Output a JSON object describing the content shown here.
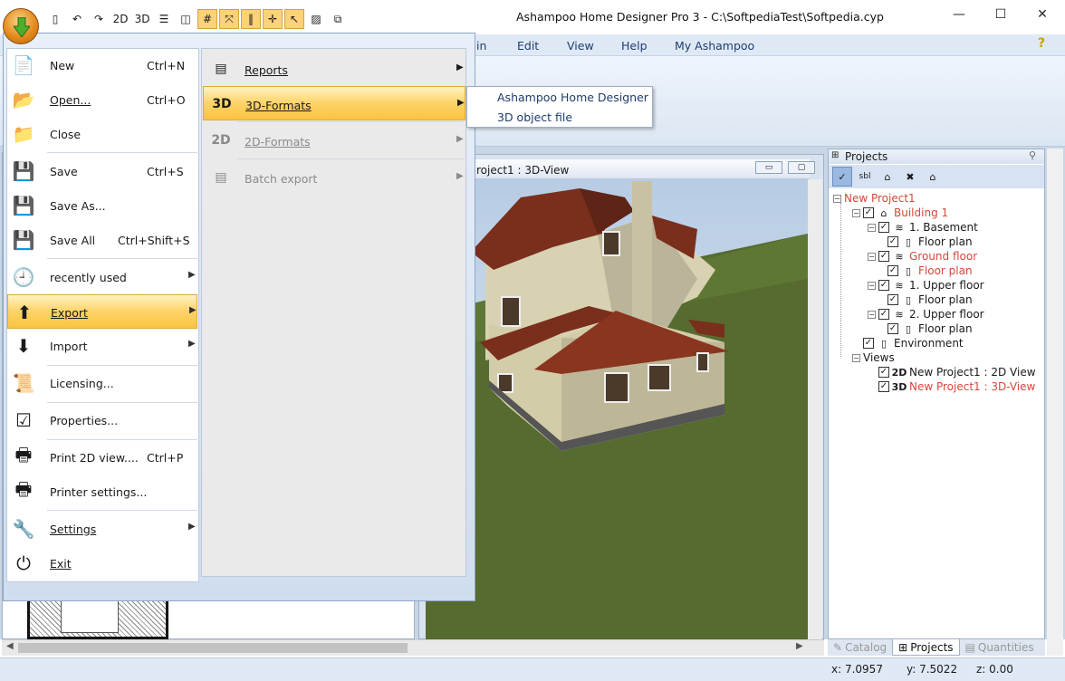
{
  "window": {
    "title": "Ashampoo Home Designer Pro 3 - C:\\SoftpediaTest\\Softpedia.cyp",
    "min_glyph": "—",
    "max_glyph": "☐",
    "close_glyph": "✕"
  },
  "quick_access": [
    {
      "icon": "new-doc-icon",
      "glyph": "▯"
    },
    {
      "icon": "undo-icon",
      "glyph": "↶"
    },
    {
      "icon": "redo-icon",
      "glyph": "↷"
    },
    {
      "icon": "view-2d-icon",
      "glyph": "2D"
    },
    {
      "icon": "view-3d-icon",
      "glyph": "3D"
    },
    {
      "icon": "split-horizontal-icon",
      "glyph": "☰"
    },
    {
      "icon": "split-vertical-icon",
      "glyph": "◫"
    },
    {
      "icon": "grid-icon",
      "glyph": "#"
    },
    {
      "icon": "snap-icon",
      "glyph": "⤧"
    },
    {
      "icon": "guides-icon",
      "glyph": "‖"
    },
    {
      "icon": "crosshair-icon",
      "glyph": "✛"
    },
    {
      "icon": "pointer-icon",
      "glyph": "↖"
    },
    {
      "icon": "texture-icon",
      "glyph": "▨"
    },
    {
      "icon": "copy-icon",
      "glyph": "⧉"
    }
  ],
  "menubar": {
    "items": [
      "in",
      "Edit",
      "View",
      "Help",
      "My Ashampoo"
    ],
    "help_glyph": "?"
  },
  "app_menu": {
    "items": [
      {
        "label": "New",
        "shortcut": "Ctrl+N",
        "icon": "new-document-icon",
        "glyph": "📄"
      },
      {
        "label": "Open...",
        "shortcut": "Ctrl+O",
        "icon": "open-folder-icon",
        "glyph": "📂"
      },
      {
        "label": "Close",
        "shortcut": "",
        "icon": "close-folder-icon",
        "glyph": "📁"
      },
      {
        "label": "Save",
        "shortcut": "Ctrl+S",
        "icon": "save-disk-icon",
        "glyph": "💾"
      },
      {
        "label": "Save As...",
        "shortcut": "",
        "icon": "save-as-icon",
        "glyph": "💾"
      },
      {
        "label": "Save All",
        "shortcut": "Ctrl+Shift+S",
        "icon": "save-all-icon",
        "glyph": "💾"
      },
      {
        "label": "recently used",
        "shortcut": "",
        "icon": "recent-files-icon",
        "glyph": "🕘"
      },
      {
        "label": "Export",
        "shortcut": "",
        "icon": "export-arrow-icon",
        "glyph": "⬆"
      },
      {
        "label": "Import",
        "shortcut": "",
        "icon": "import-arrow-icon",
        "glyph": "⬇"
      },
      {
        "label": "Licensing...",
        "shortcut": "",
        "icon": "license-certificate-icon",
        "glyph": "📜"
      },
      {
        "label": "Properties...",
        "shortcut": "",
        "icon": "properties-checklist-icon",
        "glyph": "☑"
      },
      {
        "label": "Print 2D view....",
        "shortcut": "Ctrl+P",
        "icon": "printer-icon",
        "glyph": "🖶"
      },
      {
        "label": "Printer settings...",
        "shortcut": "",
        "icon": "printer-settings-icon",
        "glyph": "🖶"
      },
      {
        "label": "Settings",
        "shortcut": "",
        "icon": "settings-tools-icon",
        "glyph": "🔧"
      },
      {
        "label": "Exit",
        "shortcut": "",
        "icon": "exit-power-icon",
        "glyph": "⏻"
      }
    ],
    "submenu_arrow": "▶"
  },
  "export_submenu": {
    "items": [
      {
        "label": "Reports",
        "icon": "reports-icon",
        "glyph": "▤"
      },
      {
        "label": "3D-Formats",
        "icon": "3d-formats-icon",
        "glyph": "3D"
      },
      {
        "label": "2D-Formats",
        "icon": "2d-formats-icon",
        "glyph": "2D"
      },
      {
        "label": "Batch export",
        "icon": "batch-export-icon",
        "glyph": "▤"
      }
    ]
  },
  "flyout": {
    "items": [
      "Ashampoo Home Designer",
      "3D object file"
    ]
  },
  "view3d": {
    "title": "roject1 : 3D-View",
    "min_glyph": "▭",
    "max_glyph": "▢"
  },
  "projects_panel": {
    "title": "Projects",
    "tools": [
      {
        "icon": "checkmark-icon",
        "glyph": "✓"
      },
      {
        "icon": "label-sbl-icon",
        "glyph": "sbl"
      },
      {
        "icon": "add-level-icon",
        "glyph": "⌂"
      },
      {
        "icon": "delete-icon",
        "glyph": "✖"
      },
      {
        "icon": "house-settings-icon",
        "glyph": "⌂"
      }
    ],
    "tree": [
      {
        "label": "New Project1",
        "icon": "",
        "glyph": "",
        "checkbox": false,
        "toggle": "−",
        "red": true
      },
      {
        "label": "Building 1",
        "icon": "building-icon",
        "glyph": "⌂",
        "checkbox": true,
        "toggle": "−",
        "red": true
      },
      {
        "label": "1. Basement",
        "icon": "floor-level-icon",
        "glyph": "≋",
        "checkbox": true,
        "toggle": "−",
        "red": false
      },
      {
        "label": "Floor plan",
        "icon": "floor-plan-page-icon",
        "glyph": "▯",
        "checkbox": true,
        "toggle": "",
        "red": false
      },
      {
        "label": "Ground floor",
        "icon": "floor-level-icon",
        "glyph": "≋",
        "checkbox": true,
        "toggle": "−",
        "red": true
      },
      {
        "label": "Floor plan",
        "icon": "floor-plan-page-icon",
        "glyph": "▯",
        "checkbox": true,
        "toggle": "",
        "red": true
      },
      {
        "label": "1. Upper floor",
        "icon": "floor-level-icon",
        "glyph": "≋",
        "checkbox": true,
        "toggle": "−",
        "red": false
      },
      {
        "label": "Floor plan",
        "icon": "floor-plan-page-icon",
        "glyph": "▯",
        "checkbox": true,
        "toggle": "",
        "red": false
      },
      {
        "label": "2. Upper floor",
        "icon": "floor-level-icon",
        "glyph": "≋",
        "checkbox": true,
        "toggle": "−",
        "red": false
      },
      {
        "label": "Floor plan",
        "icon": "floor-plan-page-icon",
        "glyph": "▯",
        "checkbox": true,
        "toggle": "",
        "red": false
      },
      {
        "label": "Environment",
        "icon": "environment-page-icon",
        "glyph": "▯",
        "checkbox": true,
        "toggle": "",
        "red": false
      },
      {
        "label": "Views",
        "icon": "",
        "glyph": "",
        "checkbox": false,
        "toggle": "−",
        "red": false
      },
      {
        "label": "New Project1 : 2D View",
        "icon": "view-2d-label-icon",
        "glyph": "2D",
        "checkbox": true,
        "toggle": "",
        "red": false
      },
      {
        "label": "New Project1 : 3D-View",
        "icon": "view-3d-label-icon",
        "glyph": "3D",
        "checkbox": true,
        "toggle": "",
        "red": true
      }
    ],
    "tabs": [
      {
        "label": "Catalog",
        "icon": "catalog-icon",
        "glyph": "✎",
        "active": false
      },
      {
        "label": "Projects",
        "icon": "projects-icon",
        "glyph": "⊞",
        "active": true
      },
      {
        "label": "Quantities",
        "icon": "quantities-icon",
        "glyph": "▤",
        "active": false
      }
    ]
  },
  "statusbar": {
    "x": "x: 7.0957",
    "y": "y: 7.5022",
    "z": "z: 0.00"
  },
  "colors": {
    "highlight": "#fbc440",
    "red_text": "#d7473a",
    "roof": "#7a2e1c",
    "grass": "#556b2f",
    "wall": "#d8d2b2"
  }
}
